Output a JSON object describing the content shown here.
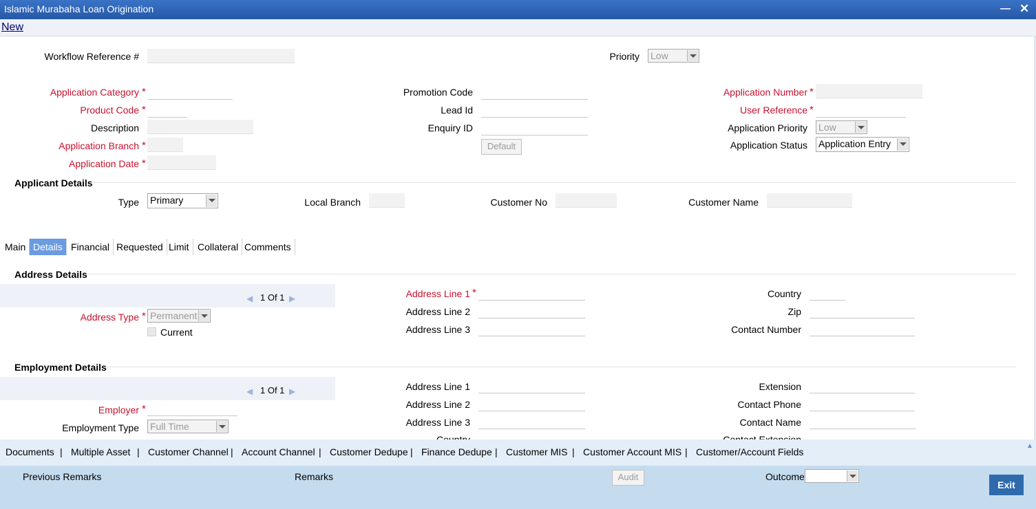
{
  "window": {
    "title": "Islamic Murabaha Loan Origination"
  },
  "menu": {
    "new": "New"
  },
  "header": {
    "workflow_ref_label": "Workflow Reference #",
    "priority_label": "Priority",
    "priority_value": "Low"
  },
  "app": {
    "category_label": "Application Category",
    "product_code_label": "Product Code",
    "description_label": "Description",
    "branch_label": "Application Branch",
    "date_label": "Application Date",
    "promotion_code_label": "Promotion Code",
    "lead_id_label": "Lead Id",
    "enquiry_id_label": "Enquiry ID",
    "default_button": "Default",
    "app_number_label": "Application Number",
    "user_ref_label": "User Reference",
    "app_priority_label": "Application Priority",
    "app_priority_value": "Low",
    "app_status_label": "Application Status",
    "app_status_value": "Application Entry"
  },
  "applicant": {
    "title": "Applicant Details",
    "type_label": "Type",
    "type_value": "Primary",
    "local_branch_label": "Local Branch",
    "customer_no_label": "Customer No",
    "customer_name_label": "Customer Name"
  },
  "tabs": [
    "Main",
    "Details",
    "Financial",
    "Requested",
    "Limit",
    "Collateral",
    "Comments"
  ],
  "address": {
    "title": "Address Details",
    "pager": "1 Of 1",
    "type_label": "Address Type",
    "type_value": "Permanent",
    "current_label": "Current",
    "line1_label": "Address Line 1",
    "line2_label": "Address Line 2",
    "line3_label": "Address Line 3",
    "country_label": "Country",
    "zip_label": "Zip",
    "contact_number_label": "Contact Number"
  },
  "employment": {
    "title": "Employment Details",
    "pager": "1 Of 1",
    "employer_label": "Employer",
    "emp_type_label": "Employment Type",
    "emp_type_value": "Full Time",
    "line1_label": "Address Line 1",
    "line2_label": "Address Line 2",
    "line3_label": "Address Line 3",
    "country_label": "Country",
    "extension_label": "Extension",
    "contact_phone_label": "Contact Phone",
    "contact_name_label": "Contact Name",
    "contact_ext_label": "Contact Extension"
  },
  "bottom_links": [
    "Documents",
    "Multiple Asset",
    "Customer Channel",
    "Account Channel",
    "Customer Dedupe",
    "Finance Dedupe",
    "Customer MIS",
    "Customer Account MIS",
    "Customer/Account Fields"
  ],
  "footer": {
    "prev_remarks": "Previous Remarks",
    "remarks": "Remarks",
    "audit": "Audit",
    "outcome": "Outcome",
    "exit": "Exit"
  }
}
